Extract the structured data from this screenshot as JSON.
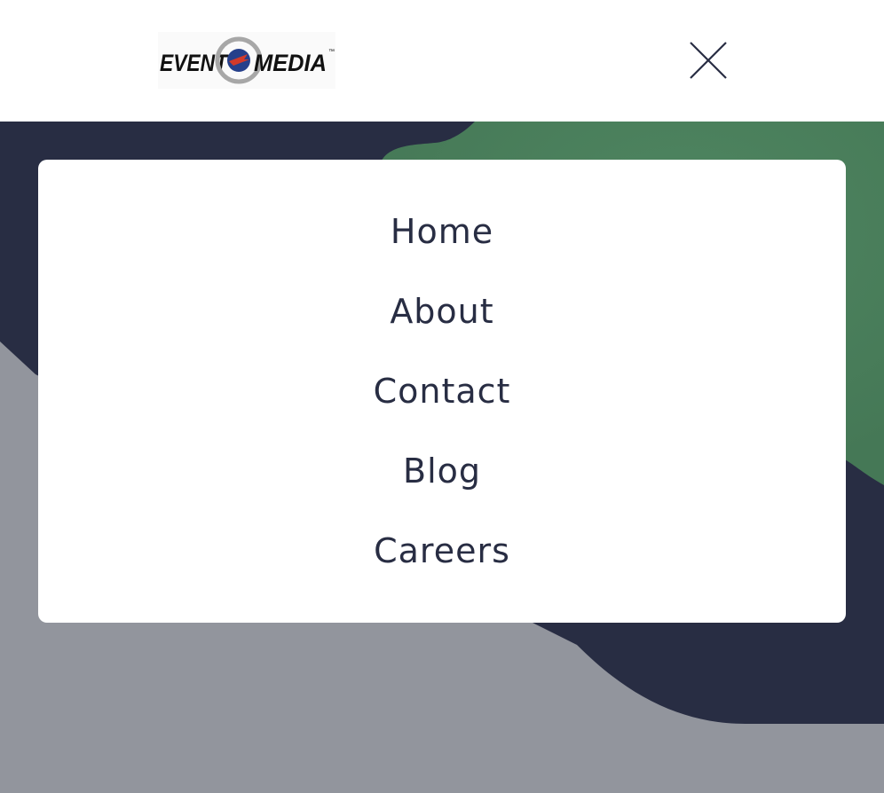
{
  "header": {
    "logo": {
      "text_left": "EVENT",
      "text_right": "MEDIA",
      "trademark": "™",
      "icon": "target-logo-icon"
    },
    "close_icon": "close-icon"
  },
  "menu": {
    "items": [
      {
        "label": "Home"
      },
      {
        "label": "About"
      },
      {
        "label": "Contact"
      },
      {
        "label": "Blog"
      },
      {
        "label": "Careers"
      }
    ]
  },
  "colors": {
    "navy": "#282d43",
    "green": "#4a7d5c",
    "gray": "#92959d",
    "text": "#282d43",
    "white": "#ffffff"
  }
}
